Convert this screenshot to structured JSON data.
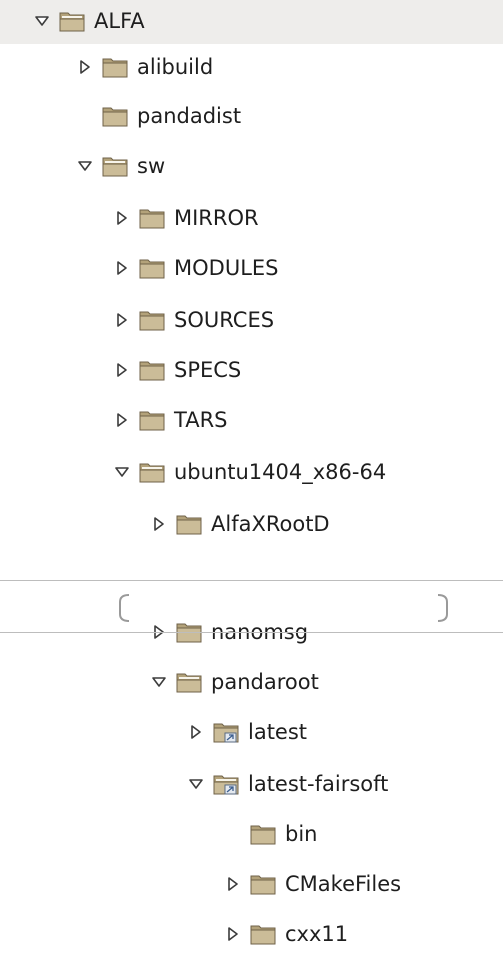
{
  "tree": {
    "items": [
      {
        "label": "ALFA",
        "state": "expanded",
        "icon": "folder-open-icon",
        "depth": 0
      },
      {
        "label": "alibuild",
        "state": "collapsed",
        "icon": "folder-icon",
        "depth": 1
      },
      {
        "label": "pandadist",
        "state": "leaf",
        "icon": "folder-icon",
        "depth": 1
      },
      {
        "label": "sw",
        "state": "expanded",
        "icon": "folder-open-icon",
        "depth": 1
      },
      {
        "label": "MIRROR",
        "state": "collapsed",
        "icon": "folder-icon",
        "depth": 2
      },
      {
        "label": "MODULES",
        "state": "collapsed",
        "icon": "folder-icon",
        "depth": 2
      },
      {
        "label": "SOURCES",
        "state": "collapsed",
        "icon": "folder-icon",
        "depth": 2
      },
      {
        "label": "SPECS",
        "state": "collapsed",
        "icon": "folder-icon",
        "depth": 2
      },
      {
        "label": "TARS",
        "state": "collapsed",
        "icon": "folder-icon",
        "depth": 2
      },
      {
        "label": "ubuntu1404_x86-64",
        "state": "expanded",
        "icon": "folder-open-icon",
        "depth": 2
      },
      {
        "label": "AlfaXRootD",
        "state": "collapsed",
        "icon": "folder-icon",
        "depth": 3
      },
      {
        "label": "nanomsg",
        "state": "collapsed",
        "icon": "folder-icon",
        "depth": 3
      },
      {
        "label": "pandaroot",
        "state": "expanded",
        "icon": "folder-open-icon",
        "depth": 3
      },
      {
        "label": "latest",
        "state": "collapsed",
        "icon": "folder-link-icon",
        "depth": 4
      },
      {
        "label": "latest-fairsoft",
        "state": "expanded",
        "icon": "folder-link-open-icon",
        "depth": 4
      },
      {
        "label": "bin",
        "state": "leaf",
        "icon": "folder-icon",
        "depth": 5
      },
      {
        "label": "CMakeFiles",
        "state": "collapsed",
        "icon": "folder-icon",
        "depth": 5
      },
      {
        "label": "cxx11",
        "state": "collapsed",
        "icon": "folder-icon",
        "depth": 5
      }
    ]
  },
  "colors": {
    "folder_body": "#cbbc98",
    "folder_tab": "#b3a27a",
    "folder_outline": "#6f6248",
    "expander": "#3c3c3c",
    "selection": "#eeedeb"
  }
}
